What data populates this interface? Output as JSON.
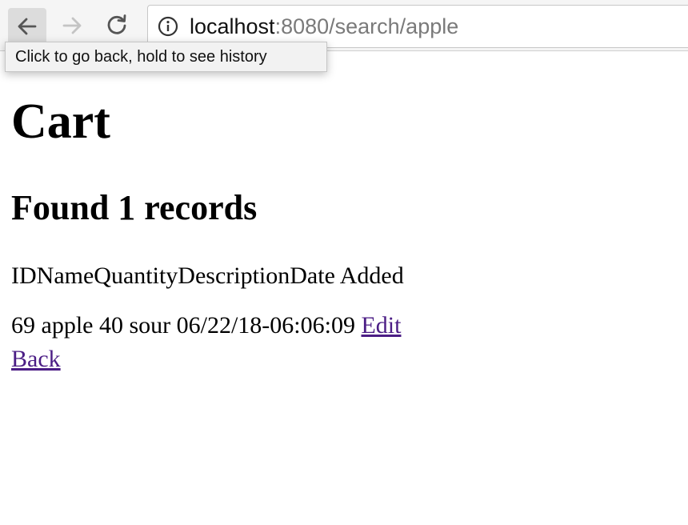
{
  "browser": {
    "url_host": "localhost",
    "url_rest": ":8080/search/apple",
    "icons": {
      "back": "back-arrow-icon",
      "forward": "forward-arrow-icon",
      "reload": "reload-icon",
      "info": "info-icon"
    },
    "tooltip": "Click to go back, hold to see history"
  },
  "page": {
    "title": "Cart",
    "found_heading": "Found 1 records",
    "columns": [
      "ID",
      "Name",
      "Quantity",
      "Description",
      "Date Added"
    ],
    "rows": [
      {
        "id": "69",
        "name": "apple",
        "quantity": "40",
        "description": "sour",
        "date_added": "06/22/18-06:06:09",
        "edit_label": "Edit"
      }
    ],
    "back_label": "Back"
  },
  "colors": {
    "link": "#4b1d85",
    "toolbar_bg": "#f5f5f5",
    "url_secondary": "#7a7a7a"
  }
}
